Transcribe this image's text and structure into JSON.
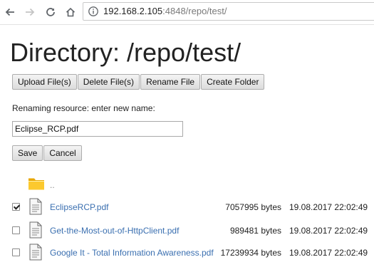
{
  "browser": {
    "url_host": "192.168.2.105",
    "url_rest": ":4848/repo/test/"
  },
  "page": {
    "title": "Directory: /repo/test/"
  },
  "toolbar_buttons": {
    "upload": "Upload File(s)",
    "delete": "Delete File(s)",
    "rename": "Rename File",
    "create_folder": "Create Folder"
  },
  "rename": {
    "label": "Renaming resource: enter new name:",
    "value": "Eclipse_RCP.pdf",
    "save": "Save",
    "cancel": "Cancel"
  },
  "parent": {
    "name": ".."
  },
  "files": [
    {
      "name": "EclipseRCP.pdf",
      "size": "7057995 bytes",
      "date": "19.08.2017 22:02:49",
      "checked": true
    },
    {
      "name": "Get-the-Most-out-of-HttpClient.pdf",
      "size": "989481 bytes",
      "date": "19.08.2017 22:02:49",
      "checked": false
    },
    {
      "name": "Google It - Total Information Awareness.pdf",
      "size": "17239934 bytes",
      "date": "19.08.2017 22:02:49",
      "checked": false
    }
  ],
  "colors": {
    "link": "#3a6fb0",
    "folder": "#f5b400"
  }
}
